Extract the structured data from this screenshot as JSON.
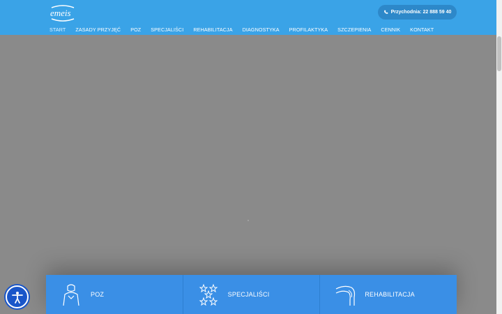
{
  "header": {
    "logo_text": "emeis",
    "phone_label": "Przychodnia: 22 888 59 40",
    "nav": [
      {
        "label": "START",
        "active": true
      },
      {
        "label": "ZASADY PRZYJĘĆ"
      },
      {
        "label": "POZ"
      },
      {
        "label": "SPECJALIŚCI"
      },
      {
        "label": "REHABILITACJA"
      },
      {
        "label": "DIAGNOSTYKA"
      },
      {
        "label": "PROFILAKTYKA",
        "has_submenu": true
      },
      {
        "label": "SZCZEPIENIA"
      },
      {
        "label": "CENNIK"
      },
      {
        "label": "KONTAKT"
      }
    ]
  },
  "cards": [
    {
      "label": "POZ",
      "icon": "body-icon"
    },
    {
      "label": "SPECJALIŚCI",
      "icon": "stars-icon"
    },
    {
      "label": "REHABILITACJA",
      "icon": "knee-icon"
    }
  ],
  "accessibility_button": {
    "icon": "accessibility-icon"
  },
  "colors": {
    "header": "#3aa3e7",
    "card": "#3a8fe6",
    "overlay": "#8a8a8a",
    "a11y": "#1a56c9"
  }
}
